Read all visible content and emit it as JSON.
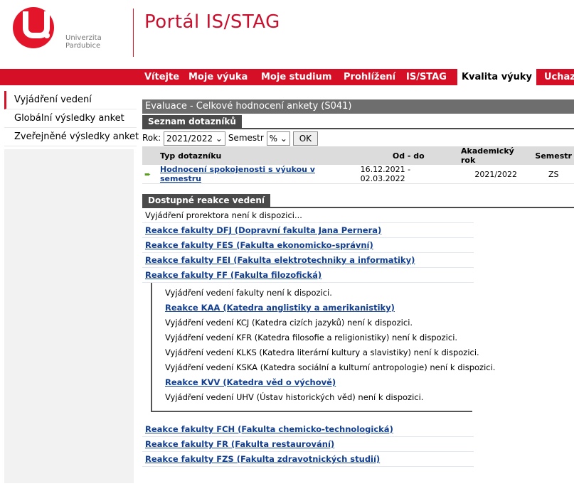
{
  "brand": {
    "logo_line1": "Univerzita",
    "logo_line2": "Pardubice",
    "portal_title": "Portál IS/STAG",
    "accent": "#d50f25"
  },
  "nav": {
    "items": [
      {
        "label": "Vítejte"
      },
      {
        "label": "Moje výuka"
      },
      {
        "label": "Moje studium"
      },
      {
        "label": "Prohlížení"
      },
      {
        "label": "IS/STAG"
      },
      {
        "label": "Kvalita výuky",
        "active": true
      },
      {
        "label": "Uchaz"
      }
    ]
  },
  "sidebar": {
    "items": [
      {
        "label": "Vyjádření vedení",
        "active": true
      },
      {
        "label": "Globální výsledky anket"
      },
      {
        "label": "Zveřejněné výsledky anket"
      }
    ]
  },
  "main": {
    "page_title": "Evaluace - Celkové hodnocení ankety (S041)",
    "list_tab": "Seznam dotazníků",
    "filter": {
      "rok_label": "Rok:",
      "rok_value": "2021/2022",
      "semestr_label": "Semestr",
      "semestr_value": "%",
      "ok_label": "OK"
    },
    "table": {
      "headers": [
        "Typ dotazníku",
        "Od - do",
        "Akademický rok",
        "Semestr"
      ],
      "rows": [
        {
          "typ": "Hodnocení spokojenosti s výukou v semestru",
          "od_do": "16.12.2021 - 02.03.2022",
          "rok": "2021/2022",
          "semestr": "ZS"
        }
      ]
    },
    "reactions_tab": "Dostupné reakce vedení",
    "reactions": [
      {
        "text": "Vyjádření prorektora není k dispozici...",
        "link": false
      },
      {
        "text": "Reakce fakulty DFJ (Dopravní fakulta Jana Pernera)",
        "link": true
      },
      {
        "text": "Reakce fakulty FES (Fakulta ekonomicko-správní)",
        "link": true
      },
      {
        "text": "Reakce fakulty FEI (Fakulta elektrotechniky a informatiky)",
        "link": true
      },
      {
        "text": "Reakce fakulty FF (Fakulta filozofická)",
        "link": true
      }
    ],
    "ff_sub": [
      {
        "text": "Vyjádření vedení fakulty není k dispozici.",
        "link": false
      },
      {
        "text": "Reakce KAA (Katedra anglistiky a amerikanistiky)",
        "link": true
      },
      {
        "text": "Vyjádření vedení KCJ (Katedra cizích jazyků) není k dispozici.",
        "link": false
      },
      {
        "text": "Vyjádření vedení KFR (Katedra filosofie a religionistiky) není k dispozici.",
        "link": false
      },
      {
        "text": "Vyjádření vedení KLKS (Katedra literární kultury a slavistiky) není k dispozici.",
        "link": false
      },
      {
        "text": "Vyjádření vedení KSKA (Katedra sociální a kulturní antropologie) není k dispozici.",
        "link": false
      },
      {
        "text": "Reakce KVV (Katedra věd o výchově)",
        "link": true
      },
      {
        "text": "Vyjádření vedení UHV (Ústav historických věd) není k dispozici.",
        "link": false
      }
    ],
    "reactions_after": [
      {
        "text": "Reakce fakulty FCH (Fakulta chemicko-technologická)",
        "link": true
      },
      {
        "text": "Reakce fakulty FR (Fakulta restaurování)",
        "link": true
      },
      {
        "text": "Reakce fakulty FZS (Fakulta zdravotnických studií)",
        "link": true
      }
    ]
  }
}
